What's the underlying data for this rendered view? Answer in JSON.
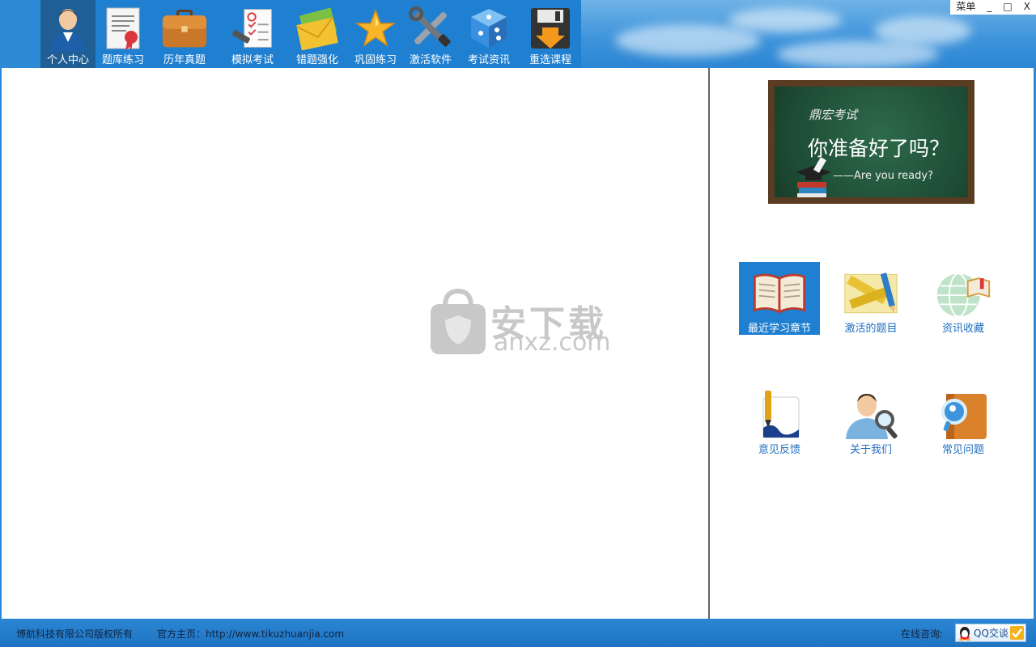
{
  "window": {
    "menu_label": "菜单",
    "minimize_glyph": "_",
    "maximize_glyph": "□",
    "close_glyph": "X"
  },
  "nav": {
    "items": [
      {
        "label": "个人中心",
        "icon": "user-icon",
        "active": true
      },
      {
        "label": "题库练习",
        "icon": "certificate-icon",
        "active": false
      },
      {
        "label": "历年真题",
        "icon": "briefcase-icon",
        "active": false
      },
      {
        "label": "模拟考试",
        "icon": "exam-paper-icon",
        "active": false
      },
      {
        "label": "错题强化",
        "icon": "envelope-icon",
        "active": false
      },
      {
        "label": "巩固练习",
        "icon": "star-icon",
        "active": false
      },
      {
        "label": "激活软件",
        "icon": "tools-icon",
        "active": false
      },
      {
        "label": "考试资讯",
        "icon": "dice-icon",
        "active": false
      },
      {
        "label": "重选课程",
        "icon": "save-download-icon",
        "active": false
      }
    ]
  },
  "banner": {
    "brand": "鼎宏考试",
    "title": "你准备好了吗？",
    "subtitle": "——Are you ready?"
  },
  "watermark": {
    "text": "安下载",
    "sub": "anxz.com"
  },
  "quick_links": [
    {
      "label": "最近学习章节",
      "icon": "open-book-icon",
      "selected": true
    },
    {
      "label": "激活的题目",
      "icon": "ruler-pencil-icon",
      "selected": false
    },
    {
      "label": "资讯收藏",
      "icon": "globe-book-icon",
      "selected": false
    },
    {
      "label": "意见反馈",
      "icon": "lesson-pen-icon",
      "selected": false
    },
    {
      "label": "关于我们",
      "icon": "person-magnifier-icon",
      "selected": false
    },
    {
      "label": "常见问题",
      "icon": "help-book-icon",
      "selected": false
    }
  ],
  "footer": {
    "copyright": "博航科技有限公司版权所有",
    "homepage": "官方主页：http://www.tikuzhuanjia.com",
    "consult_label": "在线咨询:",
    "qq_button": "QQ交谈"
  },
  "colors": {
    "toolbar_blue": "#1f7fd0",
    "active_nav": "#1f5f95",
    "footer_blue": "#1f74c2",
    "link_blue": "#1f6fc0"
  }
}
